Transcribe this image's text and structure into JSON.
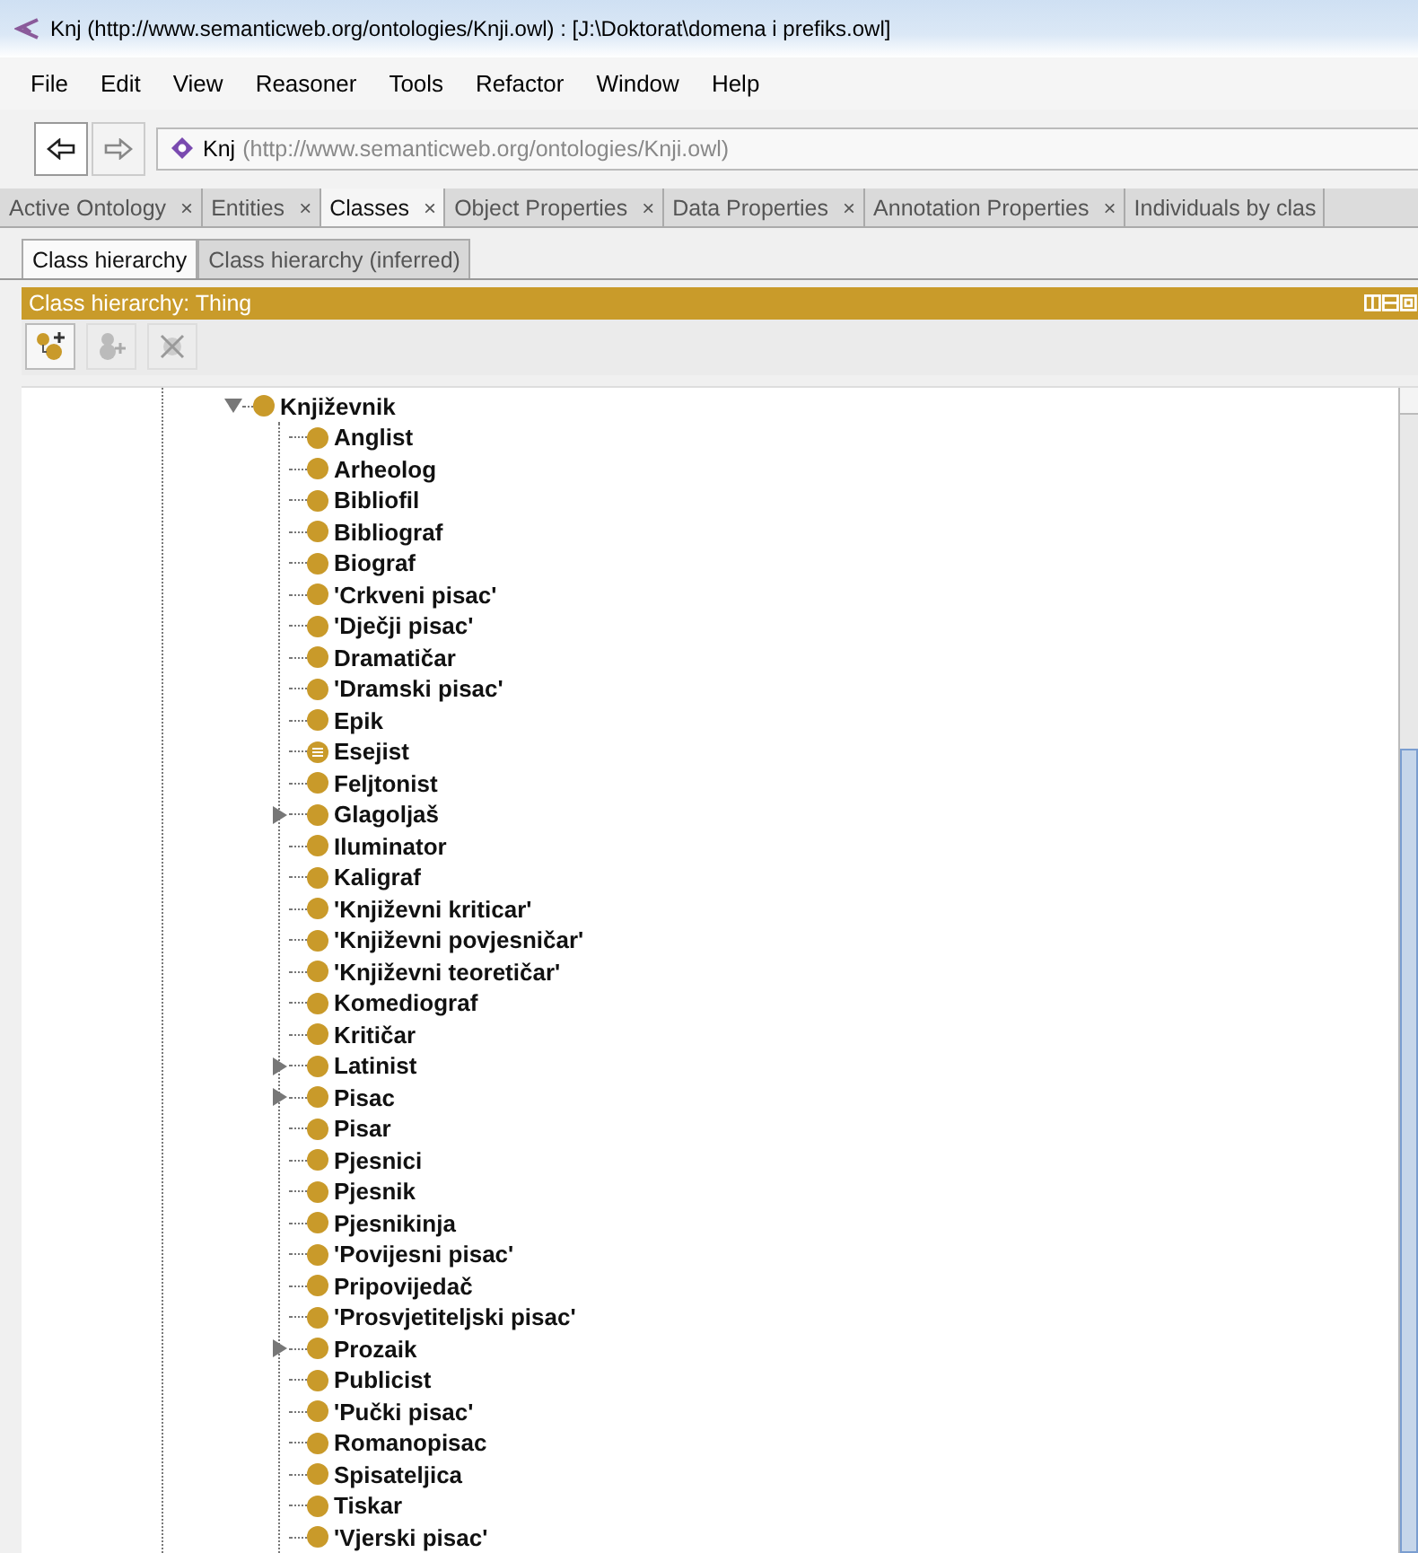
{
  "window": {
    "title": "Knj (http://www.semanticweb.org/ontologies/Knji.owl)  : [J:\\Doktorat\\domena i prefiks.owl]"
  },
  "menu": [
    "File",
    "Edit",
    "View",
    "Reasoner",
    "Tools",
    "Refactor",
    "Window",
    "Help"
  ],
  "address": {
    "name": "Knj",
    "iri": "(http://www.semanticweb.org/ontologies/Knji.owl)"
  },
  "tabs": [
    {
      "label": "Active Ontology",
      "selected": false,
      "close": "×"
    },
    {
      "label": "Entities",
      "selected": false,
      "close": "×"
    },
    {
      "label": "Classes",
      "selected": true,
      "close": "×"
    },
    {
      "label": "Object Properties",
      "selected": false,
      "close": "×"
    },
    {
      "label": "Data Properties",
      "selected": false,
      "close": "×"
    },
    {
      "label": "Annotation Properties",
      "selected": false,
      "close": "×"
    },
    {
      "label": "Individuals by clas",
      "selected": false
    }
  ],
  "subtabs": [
    {
      "label": "Class hierarchy",
      "selected": true
    },
    {
      "label": "Class hierarchy (inferred)",
      "selected": false
    }
  ],
  "panel": {
    "title": "Class hierarchy: Thing"
  },
  "tree": {
    "label": "Književnik",
    "expanded": true,
    "children": [
      {
        "label": "Anglist",
        "collapsed": false,
        "defined": false
      },
      {
        "label": "Arheolog",
        "collapsed": false,
        "defined": false
      },
      {
        "label": "Bibliofil",
        "collapsed": false,
        "defined": false
      },
      {
        "label": "Bibliograf",
        "collapsed": false,
        "defined": false
      },
      {
        "label": "Biograf",
        "collapsed": false,
        "defined": false
      },
      {
        "label": "'Crkveni pisac'",
        "collapsed": false,
        "defined": false
      },
      {
        "label": "'Dječji pisac'",
        "collapsed": false,
        "defined": false
      },
      {
        "label": "Dramatičar",
        "collapsed": false,
        "defined": false
      },
      {
        "label": "'Dramski pisac'",
        "collapsed": false,
        "defined": false
      },
      {
        "label": "Epik",
        "collapsed": false,
        "defined": false
      },
      {
        "label": "Esejist",
        "collapsed": false,
        "defined": true
      },
      {
        "label": "Feljtonist",
        "collapsed": false,
        "defined": false
      },
      {
        "label": "Glagoljaš",
        "collapsed": true,
        "defined": false
      },
      {
        "label": "Iluminator",
        "collapsed": false,
        "defined": false
      },
      {
        "label": "Kaligraf",
        "collapsed": false,
        "defined": false
      },
      {
        "label": "'Književni kriticar'",
        "collapsed": false,
        "defined": false
      },
      {
        "label": "'Književni povjesničar'",
        "collapsed": false,
        "defined": false
      },
      {
        "label": "'Književni teoretičar'",
        "collapsed": false,
        "defined": false
      },
      {
        "label": "Komediograf",
        "collapsed": false,
        "defined": false
      },
      {
        "label": "Kritičar",
        "collapsed": false,
        "defined": false
      },
      {
        "label": "Latinist",
        "collapsed": true,
        "defined": false
      },
      {
        "label": "Pisac",
        "collapsed": true,
        "defined": false
      },
      {
        "label": "Pisar",
        "collapsed": false,
        "defined": false
      },
      {
        "label": "Pjesnici",
        "collapsed": false,
        "defined": false
      },
      {
        "label": "Pjesnik",
        "collapsed": false,
        "defined": false
      },
      {
        "label": "Pjesnikinja",
        "collapsed": false,
        "defined": false
      },
      {
        "label": "'Povijesni pisac'",
        "collapsed": false,
        "defined": false
      },
      {
        "label": "Pripovijedač",
        "collapsed": false,
        "defined": false
      },
      {
        "label": "'Prosvjetiteljski pisac'",
        "collapsed": false,
        "defined": false
      },
      {
        "label": "Prozaik",
        "collapsed": true,
        "defined": false
      },
      {
        "label": "Publicist",
        "collapsed": false,
        "defined": false
      },
      {
        "label": "'Pučki pisac'",
        "collapsed": false,
        "defined": false
      },
      {
        "label": "Romanopisac",
        "collapsed": false,
        "defined": false
      },
      {
        "label": "Spisateljica",
        "collapsed": false,
        "defined": false
      },
      {
        "label": "Tiskar",
        "collapsed": false,
        "defined": false
      },
      {
        "label": "'Vjerski pisac'",
        "collapsed": false,
        "defined": false
      }
    ]
  }
}
